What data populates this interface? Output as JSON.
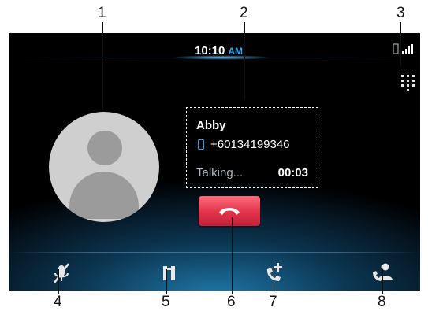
{
  "status_bar": {
    "time": "10:10",
    "ampm": "AM"
  },
  "call": {
    "contact_name": "Abby",
    "phone_number": "+60134199346",
    "status": "Talking...",
    "duration": "00:03"
  },
  "callouts": [
    "1",
    "2",
    "3",
    "4",
    "5",
    "6",
    "7",
    "8"
  ],
  "colors": {
    "end_call": "#e1334a",
    "accent": "#2fa3ef"
  }
}
